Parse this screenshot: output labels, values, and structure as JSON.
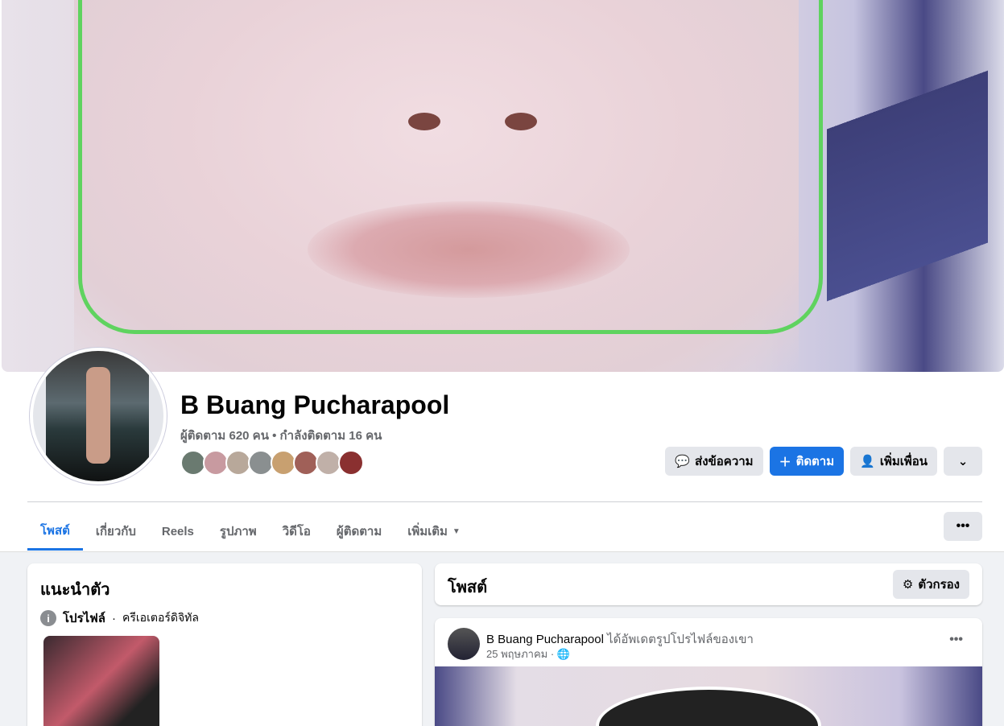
{
  "profile": {
    "name": "B Buang Pucharapool",
    "followers_line": "ผู้ติดตาม 620 คน • กำลังติดตาม 16 คน",
    "friend_avatar_colors": [
      "#6a7a70",
      "#c89aa0",
      "#b8a89a",
      "#8a8f90",
      "#c8a070",
      "#a06058",
      "#c0b0a8",
      "#8a3030"
    ]
  },
  "actions": {
    "message": "ส่งข้อความ",
    "follow": "ติดตาม",
    "add_friend": "เพิ่มเพื่อน"
  },
  "tabs": [
    "โพสต์",
    "เกี่ยวกับ",
    "Reels",
    "รูปภาพ",
    "วิดีโอ",
    "ผู้ติดตาม",
    "เพิ่มเติม"
  ],
  "intro": {
    "title": "แนะนำตัว",
    "profile_label": "โปรไฟล์",
    "category": "ครีเอเตอร์ดิจิทัล"
  },
  "posts": {
    "title": "โพสต์",
    "filter": "ตัวกรอง"
  },
  "post": {
    "author": "B Buang Pucharapool",
    "action": "ได้อัพเดตรูปโปรไฟล์ของเขา",
    "date": "25 พฤษภาคม"
  },
  "colors": {
    "accent": "#1b74e4"
  }
}
